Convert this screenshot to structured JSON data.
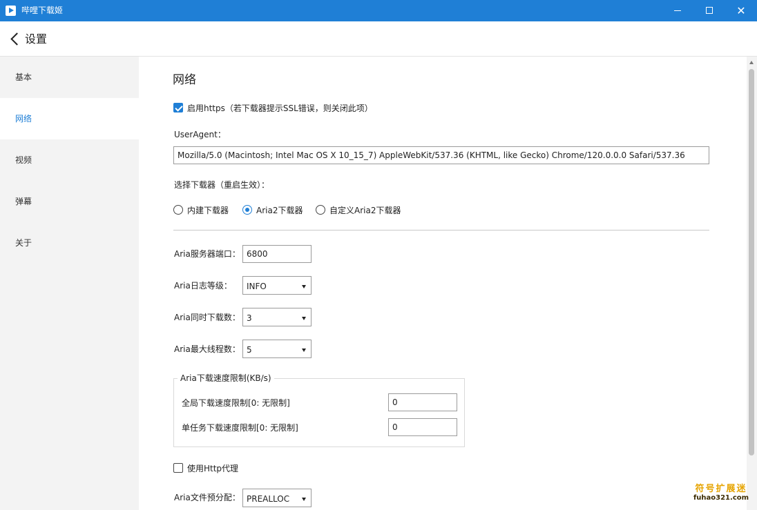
{
  "window": {
    "title": "哔哩下载姬",
    "app_icon": "play-icon",
    "controls": [
      "minimize-icon",
      "maximize-icon",
      "close-icon"
    ],
    "close_glyph": "✕"
  },
  "header": {
    "back_icon": "chevron-left-icon",
    "title": "设置"
  },
  "sidebar": {
    "active": "网络",
    "items": [
      {
        "label": "基本"
      },
      {
        "label": "网络"
      },
      {
        "label": "视频"
      },
      {
        "label": "弹幕"
      },
      {
        "label": "关于"
      }
    ]
  },
  "network": {
    "title": "网络",
    "https": {
      "label": "启用https（若下载器提示SSL错误，则关闭此项）",
      "checked": true
    },
    "user_agent": {
      "label": "UserAgent：",
      "value": "Mozilla/5.0 (Macintosh; Intel Mac OS X 10_15_7) AppleWebKit/537.36 (KHTML, like Gecko) Chrome/120.0.0.0 Safari/537.36"
    },
    "downloader": {
      "label": "选择下载器（重启生效）：",
      "options": [
        {
          "label": "内建下载器",
          "selected": false
        },
        {
          "label": "Aria2下载器",
          "selected": true
        },
        {
          "label": "自定义Aria2下载器",
          "selected": false
        }
      ]
    },
    "aria_port": {
      "label": "Aria服务器端口：",
      "value": "6800"
    },
    "aria_log_level": {
      "label": "Aria日志等级：",
      "value": "INFO"
    },
    "aria_max_concurrent": {
      "label": "Aria同时下载数：",
      "value": "3"
    },
    "aria_max_threads": {
      "label": "Aria最大线程数：",
      "value": "5"
    },
    "speed_limit": {
      "legend": "Aria下载速度限制(KB/s)",
      "global": {
        "label": "全局下载速度限制[0: 无限制]",
        "value": "0"
      },
      "per_task": {
        "label": "单任务下载速度限制[0: 无限制]",
        "value": "0"
      }
    },
    "http_proxy": {
      "label": "使用Http代理",
      "checked": false
    },
    "file_prealloc": {
      "label": "Aria文件预分配：",
      "value": "PREALLOC"
    }
  },
  "colors": {
    "accent": "#1f7fd6",
    "titlebar": "#1f7fd6",
    "sidebar_bg": "#f3f3f3"
  },
  "watermark": {
    "main": "符号扩展迷",
    "sub": "fuhao321.com"
  }
}
